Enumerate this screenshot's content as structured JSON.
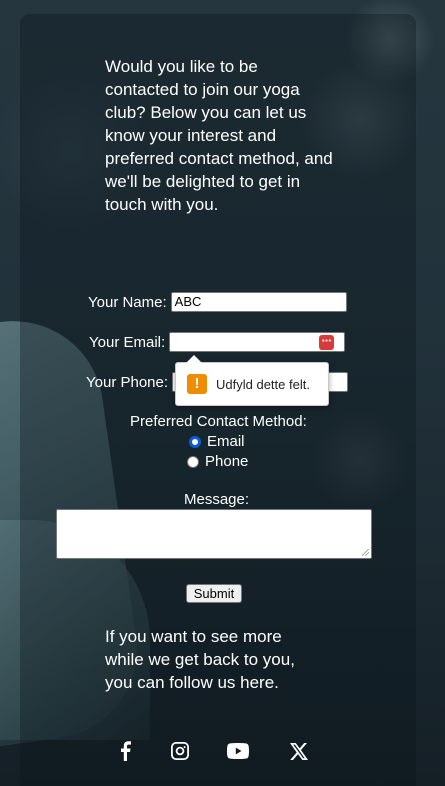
{
  "intro_text": "Would you like to be contacted to join our yoga club? Below you can let us know your interest and preferred contact method, and we'll be delighted to get in touch with you.",
  "form": {
    "name_label": "Your Name:",
    "name_value": "ABC",
    "email_label": "Your Email:",
    "email_value": "",
    "phone_label": "Your Phone:",
    "phone_value": "",
    "contact_method_label": "Preferred Contact Method:",
    "contact_options": [
      "Email",
      "Phone"
    ],
    "selected_option": "Email",
    "message_label": "Message:",
    "message_value": "",
    "submit_label": "Submit"
  },
  "validation_tooltip": {
    "text": "Udfyld dette felt.",
    "icon": "warning-icon",
    "icon_color": "#f08c00"
  },
  "follow_text": "If you want to see more while we get back to you, you can follow us here.",
  "social_icons": [
    "facebook-icon",
    "instagram-icon",
    "youtube-icon",
    "x-icon"
  ]
}
